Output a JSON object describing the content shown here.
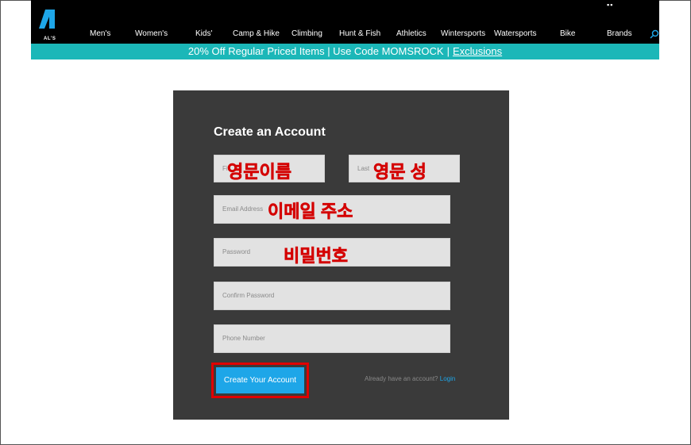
{
  "header": {
    "logo_text": "AL'S",
    "nav": [
      "Men's",
      "Women's",
      "Kids'",
      "Camp & Hike",
      "Climbing",
      "Hunt & Fish",
      "Athletics",
      "Wintersports",
      "Watersports",
      "Bike",
      "Brands"
    ],
    "dots": "▪▪",
    "search_icon": "search-icon"
  },
  "promo": {
    "text": "20% Off Regular Priced Items | Use Code MOMSROCK",
    "separator": "|",
    "link": "Exclusions"
  },
  "form": {
    "title": "Create an Account",
    "first_name_placeholder": "First Name",
    "first_name_visible": "Fi",
    "last_name_placeholder": "Last Name",
    "last_name_visible": "Last",
    "email_placeholder": "Email Address",
    "password_placeholder": "Password",
    "confirm_password_placeholder": "Confirm Password",
    "phone_placeholder": "Phone Number",
    "submit_label": "Create Your Account",
    "login_prompt": "Already have an account?",
    "login_link": "Login"
  },
  "annotations": {
    "first_name": "영문이름",
    "last_name": "영문 성",
    "email": "이메일 주소",
    "password": "비밀번호"
  },
  "colors": {
    "topbar": "#000000",
    "promo": "#1bb7b8",
    "card": "#3a3a3a",
    "button": "#1ea6e8",
    "highlight": "#e00000",
    "annotation": "#d40000"
  }
}
